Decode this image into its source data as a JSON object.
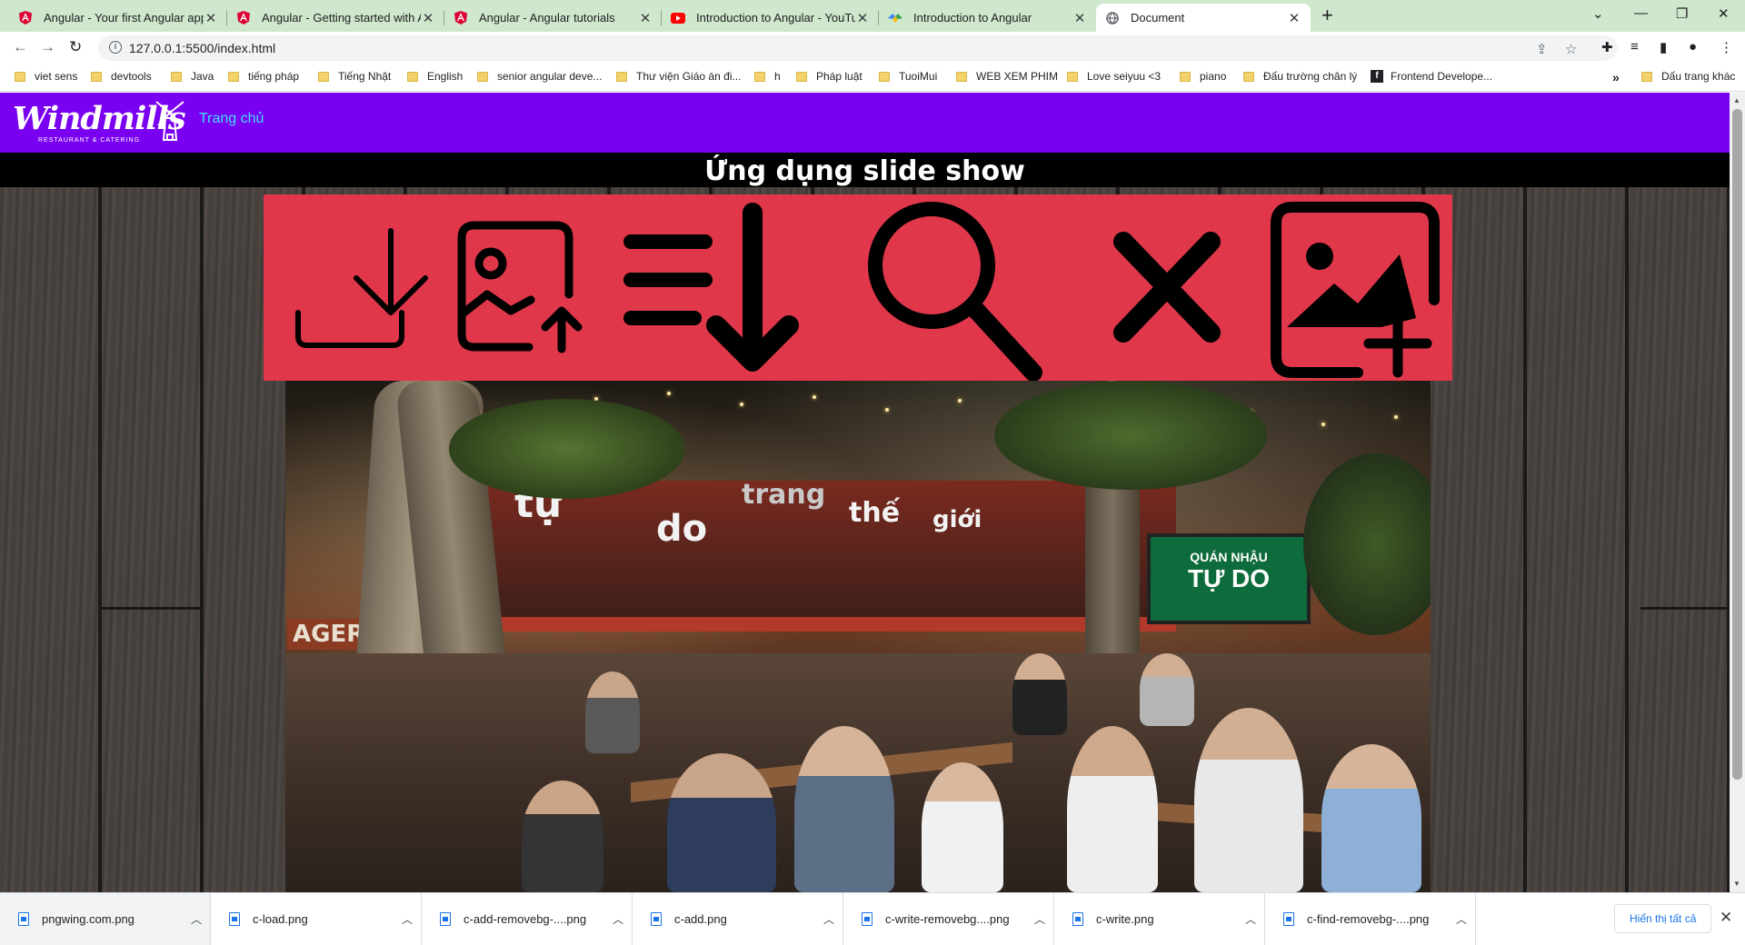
{
  "browser": {
    "tabs": [
      {
        "title": "Angular - Your first Angular app",
        "favicon": "angular-icon"
      },
      {
        "title": "Angular - Getting started with Ar",
        "favicon": "angular-icon"
      },
      {
        "title": "Angular - Angular tutorials",
        "favicon": "angular-icon"
      },
      {
        "title": "Introduction to Angular - YouTub",
        "favicon": "youtube-icon"
      },
      {
        "title": "Introduction to Angular",
        "favicon": "site-icon"
      },
      {
        "title": "Document",
        "favicon": "globe-icon",
        "active": true
      }
    ],
    "url": "127.0.0.1:5500/index.html",
    "bookmarks": [
      {
        "label": "viet sens"
      },
      {
        "label": "devtools"
      },
      {
        "label": "Java"
      },
      {
        "label": "tiếng pháp"
      },
      {
        "label": "Tiếng Nhật"
      },
      {
        "label": "English"
      },
      {
        "label": "senior angular deve..."
      },
      {
        "label": "Thư viện Giáo án đi..."
      },
      {
        "label": "h"
      },
      {
        "label": "Pháp luật"
      },
      {
        "label": "TuoiMui"
      },
      {
        "label": "WEB XEM PHIM"
      },
      {
        "label": "Love seiyuu <3"
      },
      {
        "label": "piano"
      },
      {
        "label": "Đấu trường chân lý"
      },
      {
        "label": "Frontend Develope..."
      }
    ],
    "more_bookmarks": "»",
    "other_bookmarks": "Dấu trang khác"
  },
  "page": {
    "logo": {
      "brand": "Windmills",
      "tagline": "RESTAURANT & CATERING"
    },
    "nav": {
      "home": "Trang chủ"
    },
    "heading": "Ứng dụng slide show",
    "toolbar_icons": [
      "download-icon",
      "image-upload-icon",
      "sort-down-icon",
      "search-icon",
      "close-icon",
      "add-image-icon"
    ],
    "colors": {
      "navbar": "#7a00f2",
      "nav_link": "#42e0ff",
      "icon_bar": "#e0374a"
    },
    "slide": {
      "signs": [
        "tự",
        "do",
        "trang",
        "thế",
        "giới"
      ],
      "screen": {
        "line1": "QUÁN NHẬU",
        "line2": "TỰ DO"
      },
      "poster": "AGER"
    }
  },
  "downloads": {
    "items": [
      {
        "name": "pngwing.com.png"
      },
      {
        "name": "c-load.png"
      },
      {
        "name": "c-add-removebg-....png"
      },
      {
        "name": "c-add.png"
      },
      {
        "name": "c-write-removebg....png"
      },
      {
        "name": "c-write.png"
      },
      {
        "name": "c-find-removebg-....png"
      }
    ],
    "show_all": "Hiển thị tất cả"
  }
}
